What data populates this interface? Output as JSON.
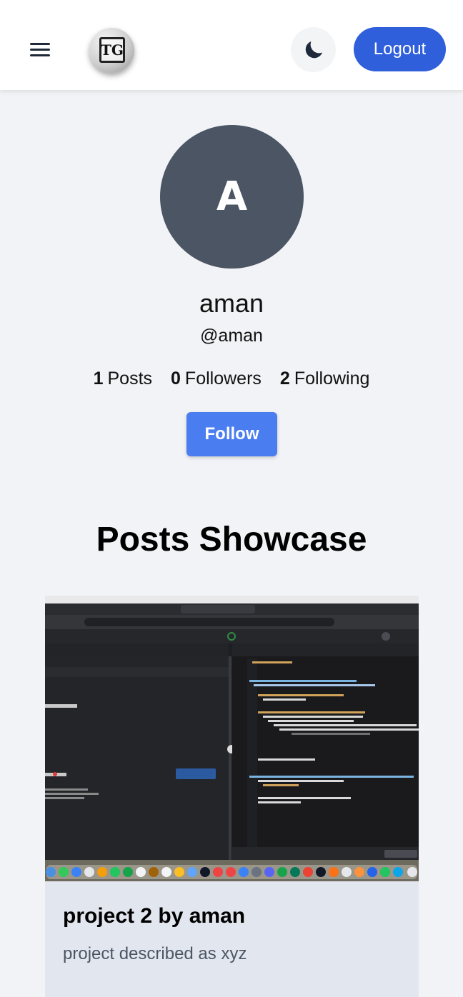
{
  "navbar": {
    "logo_text": "TG",
    "logout_label": "Logout",
    "accent_color": "#2f5fdb"
  },
  "profile": {
    "avatar_letter": "A",
    "name": "aman",
    "handle": "@aman",
    "stats": [
      {
        "count": "1",
        "label": "Posts"
      },
      {
        "count": "0",
        "label": "Followers"
      },
      {
        "count": "2",
        "label": "Following"
      }
    ],
    "follow_label": "Follow"
  },
  "showcase": {
    "title": "Posts Showcase",
    "posts": [
      {
        "title": "project 2 by aman",
        "description": "project described as xyz",
        "image_alt": "screenshot-of-code-editor"
      }
    ]
  }
}
